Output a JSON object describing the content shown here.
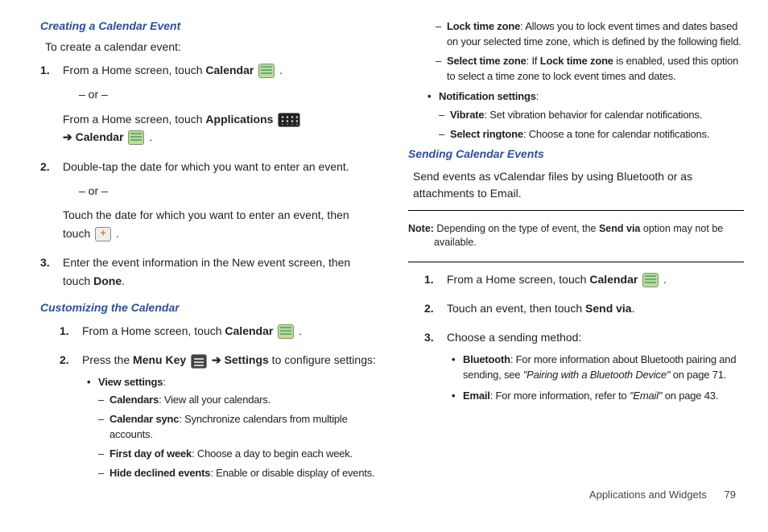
{
  "left": {
    "h_create": "Creating a Calendar Event",
    "intro_create": "To create a calendar event:",
    "steps_create": {
      "s1a_pre": "From a Home screen, touch ",
      "s1a_bold": "Calendar",
      "s1_or": "– or –",
      "s1b_pre": "From a Home screen, touch ",
      "s1b_bold": "Applications",
      "s1b_arrow": " ➔ ",
      "s1b_cal": "Calendar",
      "s2a": "Double-tap the date for which you want to enter an event.",
      "s2_or": "– or –",
      "s2b": "Touch the date for which you want to enter an event, then touch ",
      "s3_pre": "Enter the event information in the New event screen, then touch ",
      "s3_bold": "Done"
    },
    "h_custom": "Customizing the Calendar",
    "steps_custom": {
      "s1_pre": "From a Home screen, touch ",
      "s1_bold": "Calendar",
      "s2_pre": "Press the ",
      "s2_menu": "Menu Key",
      "s2_arrow": " ➔ ",
      "s2_settings": "Settings",
      "s2_post": " to configure settings:"
    },
    "view_settings_label": "View settings",
    "vs": {
      "calendars_b": "Calendars",
      "calendars_t": ": View all your calendars.",
      "sync_b": "Calendar sync",
      "sync_t": ": Synchronize calendars from multiple accounts.",
      "fdow_b": "First day of week",
      "fdow_t": ": Choose a day to begin each week.",
      "hide_b": "Hide declined events",
      "hide_t": ": Enable or disable display of events."
    }
  },
  "right": {
    "top_dash": {
      "lock_b": "Lock time zone",
      "lock_t": ": Allows you to lock event times and dates based on your selected time zone, which is defined by the following field.",
      "sel_b": "Select time zone",
      "sel_t_pre": ": If ",
      "sel_t_mid_b": "Lock time zone",
      "sel_t_post": " is enabled, used this option to select a time zone to lock event times and dates."
    },
    "notif_label": "Notification settings",
    "notif": {
      "vib_b": "Vibrate",
      "vib_t": ": Set vibration behavior for calendar notifications.",
      "ring_b": "Select ringtone",
      "ring_t": ": Choose a tone for calendar notifications."
    },
    "h_send": "Sending Calendar Events",
    "send_intro": "Send events as vCalendar files by using Bluetooth or as attachments to Email.",
    "note_b": "Note:",
    "note_t": " Depending on the type of event, the ",
    "note_mid_b": "Send via",
    "note_post": " option may not be available.",
    "steps_send": {
      "s1_pre": "From a Home screen, touch ",
      "s1_bold": "Calendar",
      "s2_pre": "Touch an event, then touch ",
      "s2_bold": "Send via",
      "s3": "Choose a sending method:"
    },
    "methods": {
      "bt_b": "Bluetooth",
      "bt_t_pre": ": For more information about Bluetooth pairing and sending, see ",
      "bt_q": "\"Pairing with a Bluetooth Device\"",
      "bt_t_post": " on page 71.",
      "em_b": "Email",
      "em_t_pre": ": For more information, refer to ",
      "em_q": "\"Email\" ",
      "em_t_post": " on page 43."
    }
  },
  "footer": {
    "section": "Applications and Widgets",
    "page": "79"
  }
}
